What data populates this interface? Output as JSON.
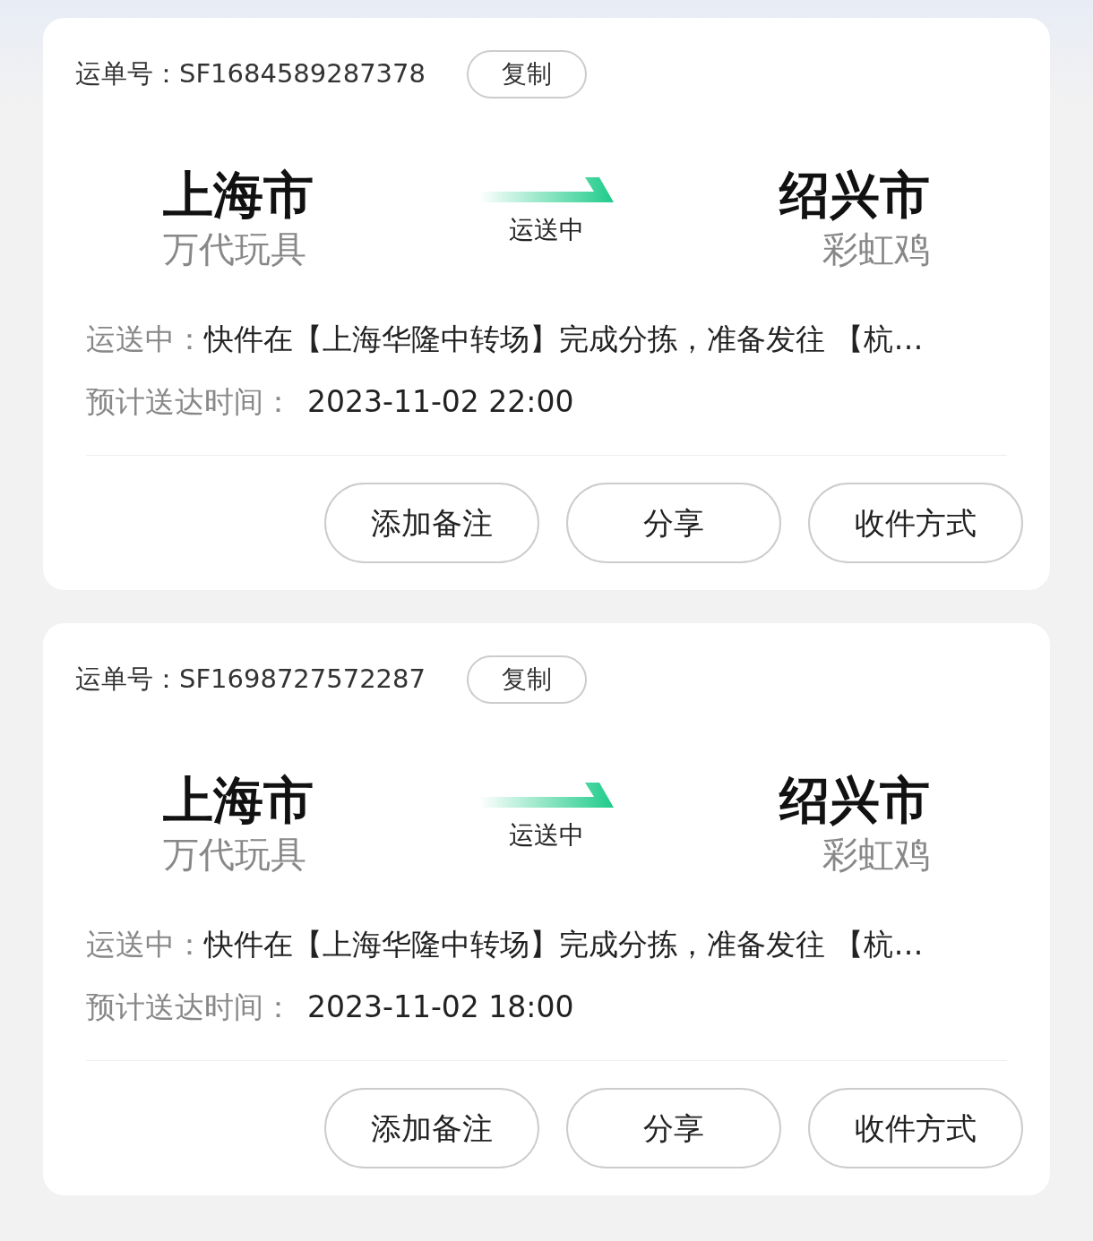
{
  "shipments": [
    {
      "waybill_label": "运单号：SF1684589287378",
      "copy_button": "复制",
      "origin_city": "上海市",
      "origin_sender": "万代玩具",
      "status": "运送中",
      "destination_city": "绍兴市",
      "destination_receiver": "彩虹鸡",
      "progress_label": "运送中：",
      "progress_text": "快件在【上海华隆中转场】完成分拣，准备发往 【杭…",
      "eta_label": "预计送达时间：",
      "eta_value": "2023-11-02 22:00",
      "actions": [
        "添加备注",
        "分享",
        "收件方式"
      ]
    },
    {
      "waybill_label": "运单号：SF1698727572287",
      "copy_button": "复制",
      "origin_city": "上海市",
      "origin_sender": "万代玩具",
      "status": "运送中",
      "destination_city": "绍兴市",
      "destination_receiver": "彩虹鸡",
      "progress_label": "运送中：",
      "progress_text": "快件在【上海华隆中转场】完成分拣，准备发往 【杭…",
      "eta_label": "预计送达时间：",
      "eta_value": "2023-11-02 18:00",
      "actions": [
        "添加备注",
        "分享",
        "收件方式"
      ]
    }
  ]
}
